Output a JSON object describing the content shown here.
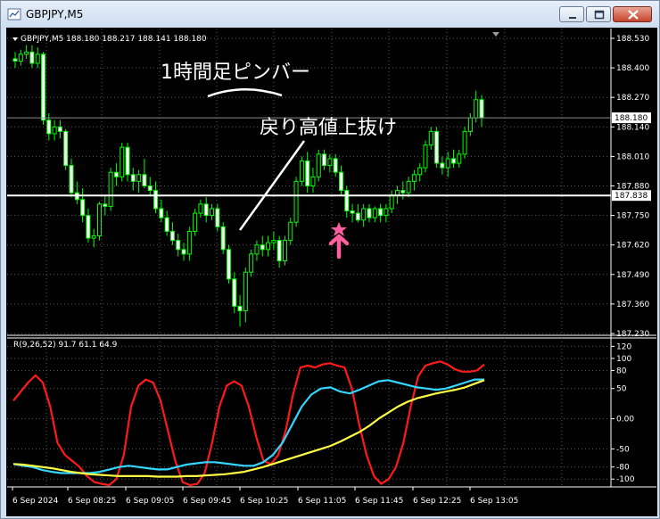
{
  "window": {
    "title": "GBPJPY,M5",
    "buttons": {
      "minimize": "minimize",
      "maximize": "maximize",
      "close": "close"
    }
  },
  "chart_data": [
    {
      "type": "candlestick",
      "symbol_line": "GBPJPY,M5  188.180 188.217 188.141 188.180",
      "annotations": {
        "pin_bar_label": "1時間足ピンバー",
        "breakout_label": "戻り高値上抜け"
      },
      "price_ticks": [
        "188.530",
        "188.400",
        "188.270",
        "188.140",
        "188.010",
        "187.880",
        "187.750",
        "187.620",
        "187.490",
        "187.360",
        "187.230"
      ],
      "ylim": [
        187.23,
        188.53
      ],
      "last_price": "188.180",
      "horizontal_level": "187.838",
      "horizontal_level_value": 187.838,
      "time_labels": [
        "6 Sep 2024",
        "6 Sep 08:25",
        "6 Sep 09:05",
        "6 Sep 09:45",
        "6 Sep 10:25",
        "6 Sep 11:05",
        "6 Sep 11:45",
        "6 Sep 12:25",
        "6 Sep 13:05"
      ],
      "candles": [
        {
          "o": 188.44,
          "h": 188.47,
          "l": 188.4,
          "c": 188.43
        },
        {
          "o": 188.43,
          "h": 188.48,
          "l": 188.41,
          "c": 188.46
        },
        {
          "o": 188.46,
          "h": 188.5,
          "l": 188.44,
          "c": 188.47
        },
        {
          "o": 188.47,
          "h": 188.5,
          "l": 188.4,
          "c": 188.42
        },
        {
          "o": 188.42,
          "h": 188.49,
          "l": 188.4,
          "c": 188.46
        },
        {
          "o": 188.46,
          "h": 188.47,
          "l": 188.15,
          "c": 188.17
        },
        {
          "o": 188.17,
          "h": 188.2,
          "l": 188.08,
          "c": 188.11
        },
        {
          "o": 188.11,
          "h": 188.17,
          "l": 188.08,
          "c": 188.14
        },
        {
          "o": 188.14,
          "h": 188.17,
          "l": 188.09,
          "c": 188.12
        },
        {
          "o": 188.12,
          "h": 188.13,
          "l": 187.95,
          "c": 187.97
        },
        {
          "o": 187.97,
          "h": 188.0,
          "l": 187.83,
          "c": 187.85
        },
        {
          "o": 187.85,
          "h": 187.9,
          "l": 187.8,
          "c": 187.82
        },
        {
          "o": 187.82,
          "h": 187.87,
          "l": 187.72,
          "c": 187.75
        },
        {
          "o": 187.75,
          "h": 187.78,
          "l": 187.63,
          "c": 187.65
        },
        {
          "o": 187.65,
          "h": 187.69,
          "l": 187.61,
          "c": 187.66
        },
        {
          "o": 187.66,
          "h": 187.81,
          "l": 187.64,
          "c": 187.8
        },
        {
          "o": 187.8,
          "h": 187.84,
          "l": 187.75,
          "c": 187.79
        },
        {
          "o": 187.79,
          "h": 187.96,
          "l": 187.77,
          "c": 187.94
        },
        {
          "o": 187.94,
          "h": 187.98,
          "l": 187.88,
          "c": 187.92
        },
        {
          "o": 187.92,
          "h": 188.07,
          "l": 187.9,
          "c": 188.05
        },
        {
          "o": 188.05,
          "h": 188.07,
          "l": 187.9,
          "c": 187.93
        },
        {
          "o": 187.93,
          "h": 187.96,
          "l": 187.86,
          "c": 187.9
        },
        {
          "o": 187.9,
          "h": 187.95,
          "l": 187.85,
          "c": 187.93
        },
        {
          "o": 187.93,
          "h": 188.0,
          "l": 187.87,
          "c": 187.88
        },
        {
          "o": 187.88,
          "h": 187.92,
          "l": 187.84,
          "c": 187.86
        },
        {
          "o": 187.86,
          "h": 187.9,
          "l": 187.76,
          "c": 187.78
        },
        {
          "o": 187.78,
          "h": 187.82,
          "l": 187.72,
          "c": 187.74
        },
        {
          "o": 187.74,
          "h": 187.77,
          "l": 187.66,
          "c": 187.68
        },
        {
          "o": 187.68,
          "h": 187.72,
          "l": 187.62,
          "c": 187.64
        },
        {
          "o": 187.64,
          "h": 187.67,
          "l": 187.57,
          "c": 187.6
        },
        {
          "o": 187.6,
          "h": 187.63,
          "l": 187.55,
          "c": 187.58
        },
        {
          "o": 187.58,
          "h": 187.7,
          "l": 187.55,
          "c": 187.68
        },
        {
          "o": 187.68,
          "h": 187.78,
          "l": 187.66,
          "c": 187.76
        },
        {
          "o": 187.76,
          "h": 187.82,
          "l": 187.74,
          "c": 187.8
        },
        {
          "o": 187.8,
          "h": 187.83,
          "l": 187.72,
          "c": 187.75
        },
        {
          "o": 187.75,
          "h": 187.8,
          "l": 187.73,
          "c": 187.78
        },
        {
          "o": 187.78,
          "h": 187.8,
          "l": 187.68,
          "c": 187.7
        },
        {
          "o": 187.7,
          "h": 187.72,
          "l": 187.58,
          "c": 187.6
        },
        {
          "o": 187.6,
          "h": 187.62,
          "l": 187.45,
          "c": 187.47
        },
        {
          "o": 187.47,
          "h": 187.5,
          "l": 187.32,
          "c": 187.35
        },
        {
          "o": 187.35,
          "h": 187.4,
          "l": 187.26,
          "c": 187.33
        },
        {
          "o": 187.33,
          "h": 187.52,
          "l": 187.28,
          "c": 187.5
        },
        {
          "o": 187.5,
          "h": 187.6,
          "l": 187.48,
          "c": 187.58
        },
        {
          "o": 187.58,
          "h": 187.64,
          "l": 187.55,
          "c": 187.62
        },
        {
          "o": 187.62,
          "h": 187.66,
          "l": 187.57,
          "c": 187.6
        },
        {
          "o": 187.6,
          "h": 187.66,
          "l": 187.57,
          "c": 187.63
        },
        {
          "o": 187.63,
          "h": 187.68,
          "l": 187.6,
          "c": 187.64
        },
        {
          "o": 187.64,
          "h": 187.66,
          "l": 187.52,
          "c": 187.55
        },
        {
          "o": 187.55,
          "h": 187.66,
          "l": 187.53,
          "c": 187.64
        },
        {
          "o": 187.64,
          "h": 187.74,
          "l": 187.62,
          "c": 187.72
        },
        {
          "o": 187.72,
          "h": 187.92,
          "l": 187.7,
          "c": 187.9
        },
        {
          "o": 187.9,
          "h": 188.01,
          "l": 187.88,
          "c": 187.99
        },
        {
          "o": 187.99,
          "h": 188.03,
          "l": 187.85,
          "c": 187.88
        },
        {
          "o": 187.88,
          "h": 187.96,
          "l": 187.85,
          "c": 187.92
        },
        {
          "o": 187.92,
          "h": 188.04,
          "l": 187.9,
          "c": 188.02
        },
        {
          "o": 188.02,
          "h": 188.04,
          "l": 187.95,
          "c": 187.97
        },
        {
          "o": 187.97,
          "h": 188.02,
          "l": 187.94,
          "c": 188.0
        },
        {
          "o": 188.0,
          "h": 188.02,
          "l": 187.92,
          "c": 187.94
        },
        {
          "o": 187.94,
          "h": 187.97,
          "l": 187.84,
          "c": 187.86
        },
        {
          "o": 187.86,
          "h": 187.88,
          "l": 187.74,
          "c": 187.77
        },
        {
          "o": 187.77,
          "h": 187.8,
          "l": 187.72,
          "c": 187.76
        },
        {
          "o": 187.76,
          "h": 187.8,
          "l": 187.72,
          "c": 187.73
        },
        {
          "o": 187.73,
          "h": 187.8,
          "l": 187.7,
          "c": 187.78
        },
        {
          "o": 187.78,
          "h": 187.8,
          "l": 187.72,
          "c": 187.74
        },
        {
          "o": 187.74,
          "h": 187.79,
          "l": 187.72,
          "c": 187.78
        },
        {
          "o": 187.78,
          "h": 187.8,
          "l": 187.72,
          "c": 187.75
        },
        {
          "o": 187.75,
          "h": 187.8,
          "l": 187.72,
          "c": 187.78
        },
        {
          "o": 187.78,
          "h": 187.86,
          "l": 187.76,
          "c": 187.84
        },
        {
          "o": 187.84,
          "h": 187.88,
          "l": 187.8,
          "c": 187.86
        },
        {
          "o": 187.86,
          "h": 187.9,
          "l": 187.82,
          "c": 187.85
        },
        {
          "o": 187.85,
          "h": 187.92,
          "l": 187.83,
          "c": 187.9
        },
        {
          "o": 187.9,
          "h": 187.95,
          "l": 187.86,
          "c": 187.93
        },
        {
          "o": 187.93,
          "h": 187.98,
          "l": 187.9,
          "c": 187.96
        },
        {
          "o": 187.96,
          "h": 188.08,
          "l": 187.94,
          "c": 188.06
        },
        {
          "o": 188.06,
          "h": 188.14,
          "l": 188.04,
          "c": 188.12
        },
        {
          "o": 188.12,
          "h": 188.14,
          "l": 187.96,
          "c": 187.98
        },
        {
          "o": 187.98,
          "h": 188.01,
          "l": 187.93,
          "c": 187.96
        },
        {
          "o": 187.96,
          "h": 188.03,
          "l": 187.92,
          "c": 188.0
        },
        {
          "o": 188.0,
          "h": 188.04,
          "l": 187.96,
          "c": 187.98
        },
        {
          "o": 187.98,
          "h": 188.04,
          "l": 187.96,
          "c": 188.02
        },
        {
          "o": 188.02,
          "h": 188.14,
          "l": 188.0,
          "c": 188.12
        },
        {
          "o": 188.12,
          "h": 188.2,
          "l": 188.1,
          "c": 188.18
        },
        {
          "o": 188.18,
          "h": 188.3,
          "l": 188.16,
          "c": 188.26
        },
        {
          "o": 188.26,
          "h": 188.28,
          "l": 188.14,
          "c": 188.18
        }
      ],
      "sub_panel": {
        "label": "R(9,26,52) 91.7 61.1 64.9",
        "ticks": [
          "120",
          "100",
          "80",
          "50",
          "0.00",
          "-50",
          "-80",
          "-100"
        ],
        "tick_values": [
          120,
          100,
          80,
          50,
          0,
          -50,
          -80,
          -100
        ],
        "ylim": [
          -110,
          125
        ],
        "series": [
          {
            "color": "#ff1a1a",
            "values": [
              30,
              45,
              60,
              72,
              60,
              20,
              -40,
              -60,
              -70,
              -80,
              -95,
              -105,
              -108,
              -110,
              -100,
              -60,
              20,
              55,
              65,
              60,
              30,
              -20,
              -70,
              -105,
              -110,
              -108,
              -90,
              -40,
              20,
              55,
              62,
              55,
              20,
              -30,
              -70,
              -75,
              -60,
              -20,
              40,
              85,
              88,
              85,
              90,
              92,
              88,
              85,
              50,
              -10,
              -60,
              -95,
              -108,
              -100,
              -80,
              -40,
              20,
              70,
              88,
              92,
              95,
              90,
              82,
              78,
              78,
              80,
              90
            ]
          },
          {
            "color": "#33d6ff",
            "values": [
              -75,
              -78,
              -80,
              -85,
              -88,
              -90,
              -90,
              -90,
              -90,
              -88,
              -84,
              -80,
              -78,
              -80,
              -82,
              -84,
              -84,
              -80,
              -76,
              -74,
              -72,
              -72,
              -74,
              -76,
              -78,
              -78,
              -72,
              -60,
              -40,
              -10,
              20,
              40,
              50,
              52,
              45,
              42,
              48,
              55,
              62,
              64,
              60,
              56,
              52,
              50,
              48,
              50,
              55,
              60,
              65,
              65
            ]
          },
          {
            "color": "#ffff44",
            "values": [
              -75,
              -76,
              -78,
              -80,
              -82,
              -85,
              -88,
              -90,
              -92,
              -93,
              -94,
              -95,
              -95,
              -95,
              -95,
              -96,
              -96,
              -96,
              -95,
              -95,
              -94,
              -93,
              -92,
              -90,
              -88,
              -84,
              -80,
              -75,
              -70,
              -65,
              -60,
              -55,
              -50,
              -45,
              -38,
              -30,
              -22,
              -12,
              0,
              10,
              20,
              28,
              34,
              38,
              42,
              45,
              48,
              52,
              58,
              64
            ]
          }
        ]
      }
    }
  ]
}
